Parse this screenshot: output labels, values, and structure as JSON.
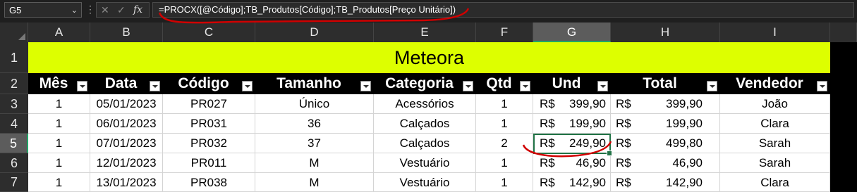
{
  "namebox": "G5",
  "formula": "=PROCX([@Código];TB_Produtos[Código];TB_Produtos[Preço Unitário])",
  "columns": [
    "A",
    "B",
    "C",
    "D",
    "E",
    "F",
    "G",
    "H",
    "I"
  ],
  "selected_column": "G",
  "rows": [
    "1",
    "2",
    "3",
    "4",
    "5",
    "6",
    "7"
  ],
  "selected_row": "5",
  "title": "Meteora",
  "headers": [
    "Mês",
    "Data",
    "Código",
    "Tamanho",
    "Categoria",
    "Qtd",
    "Und",
    "Total",
    "Vendedor"
  ],
  "currency": "R$",
  "data": [
    [
      "1",
      "05/01/2023",
      "PR027",
      "Único",
      "Acessórios",
      "1",
      "399,90",
      "399,90",
      "João"
    ],
    [
      "1",
      "06/01/2023",
      "PR031",
      "36",
      "Calçados",
      "1",
      "199,90",
      "199,90",
      "Clara"
    ],
    [
      "1",
      "07/01/2023",
      "PR032",
      "37",
      "Calçados",
      "2",
      "249,90",
      "499,80",
      "Sarah"
    ],
    [
      "1",
      "12/01/2023",
      "PR011",
      "M",
      "Vestuário",
      "1",
      "46,90",
      "46,90",
      "Sarah"
    ],
    [
      "1",
      "13/01/2023",
      "PR038",
      "M",
      "Vestuário",
      "1",
      "142,90",
      "142,90",
      "Clara"
    ]
  ],
  "colors": {
    "title_band": "#ddff00",
    "selection": "#217346",
    "annotation": "#d00000"
  },
  "icons": [
    "chevron-down-icon",
    "cancel-icon",
    "enter-icon",
    "fx-icon",
    "filter-dropdown-icon"
  ]
}
